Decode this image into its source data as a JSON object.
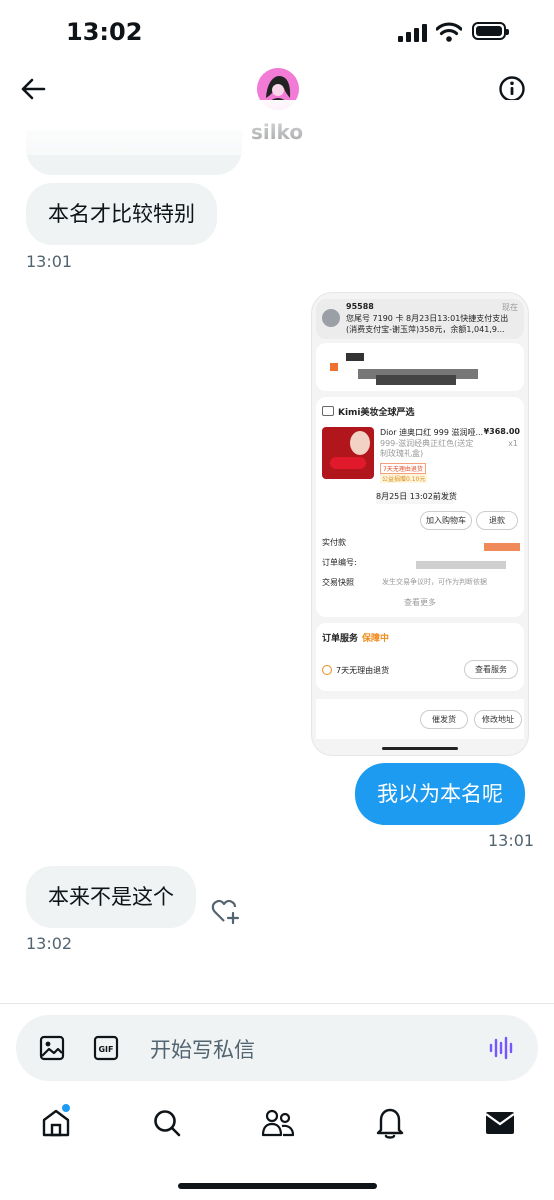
{
  "status_bar": {
    "time": "13:02"
  },
  "header": {
    "username": "silko"
  },
  "messages": {
    "incoming_1": {
      "text": "本名才比较特别",
      "time": "13:01"
    },
    "outgoing_1": {
      "text": "我以为本名呢",
      "time": "13:01"
    },
    "incoming_2": {
      "text": "本来不是这个",
      "time": "13:02"
    }
  },
  "screenshot": {
    "notif_sender": "95588",
    "notif_time": "现在",
    "notif_line1": "您尾号 7190 卡 8月23日13:01快捷支付支出",
    "notif_line2": "(消费支付宝-谢玉萍)358元，余额1,041,9...",
    "store_name": "Kimi美妆全球严选",
    "product_title": "Dior 迪奥口红 999 滋润哑...",
    "product_price": "¥368.00",
    "product_qty": "x1",
    "product_variant": "999-滋润经典正红色(送定制玫瑰礼盒)",
    "tag_return": "7天无理由退货",
    "tag_insurance": "公益捐赠0.10元",
    "ship_note": "8月25日 13:02前发货",
    "btn_cart": "加入购物车",
    "btn_refund": "退款",
    "paid_label": "实付款",
    "order_no_label": "订单编号:",
    "snapshot_label": "交易快照",
    "snapshot_note": "发生交易争议时，可作为判断依据",
    "view_more": "查看更多",
    "service_title": "订单服务",
    "service_status": "保障中",
    "service_item": "7天无理由退货",
    "btn_service": "查看服务",
    "btn_urge": "催发货",
    "btn_address": "修改地址"
  },
  "composer": {
    "placeholder": "开始写私信"
  },
  "colors": {
    "accent": "#1d9bf0",
    "bubble_in": "#eff3f4",
    "voice": "#7856ff"
  }
}
